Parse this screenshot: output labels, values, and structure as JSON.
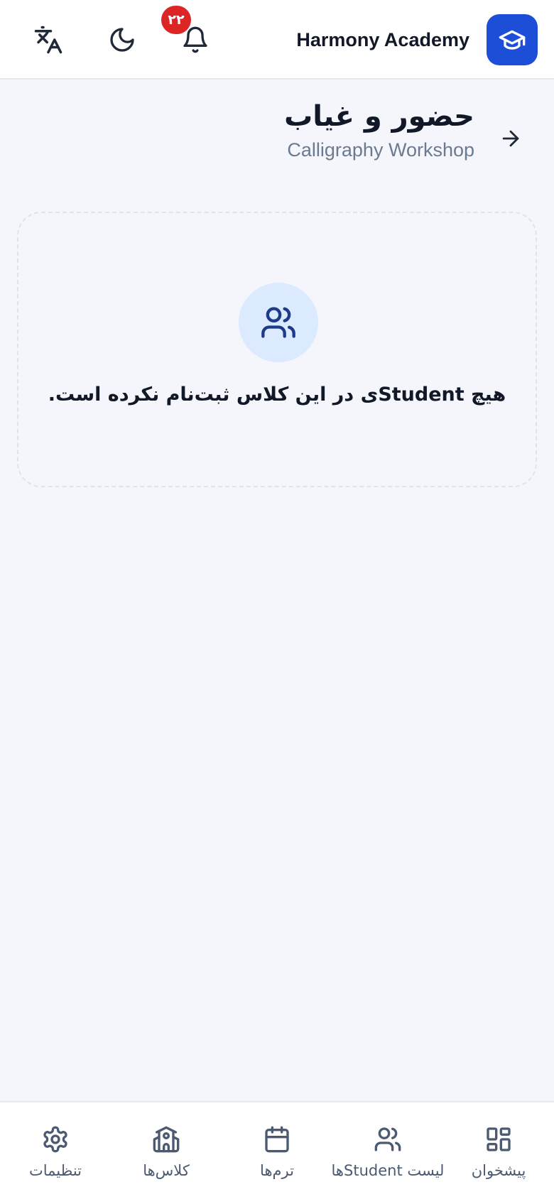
{
  "header": {
    "brand_name": "Harmony Academy",
    "notification_count": "۲۲",
    "icons": {
      "logo": "graduation-cap-icon",
      "notifications": "bell-icon",
      "theme": "moon-icon",
      "language": "translate-icon"
    }
  },
  "page": {
    "title": "حضور و غیاب",
    "subtitle": "Calligraphy Workshop",
    "back_icon": "arrow-right-icon"
  },
  "empty_state": {
    "icon": "users-icon",
    "message": "هیچ Studentی در این کلاس ثبت‌نام نکرده است."
  },
  "bottom_nav": {
    "items": [
      {
        "label": "پیشخوان",
        "icon": "dashboard-icon"
      },
      {
        "label": "لیست Studentها",
        "icon": "users-icon"
      },
      {
        "label": "ترم‌ها",
        "icon": "calendar-icon"
      },
      {
        "label": "کلاس‌ها",
        "icon": "school-building-icon"
      },
      {
        "label": "تنظیمات",
        "icon": "gear-icon"
      }
    ]
  },
  "colors": {
    "accent": "#1d4ed8",
    "badge": "#dc2626",
    "background": "#f4f6fb",
    "icon_soft_bg": "#dbeafe"
  }
}
